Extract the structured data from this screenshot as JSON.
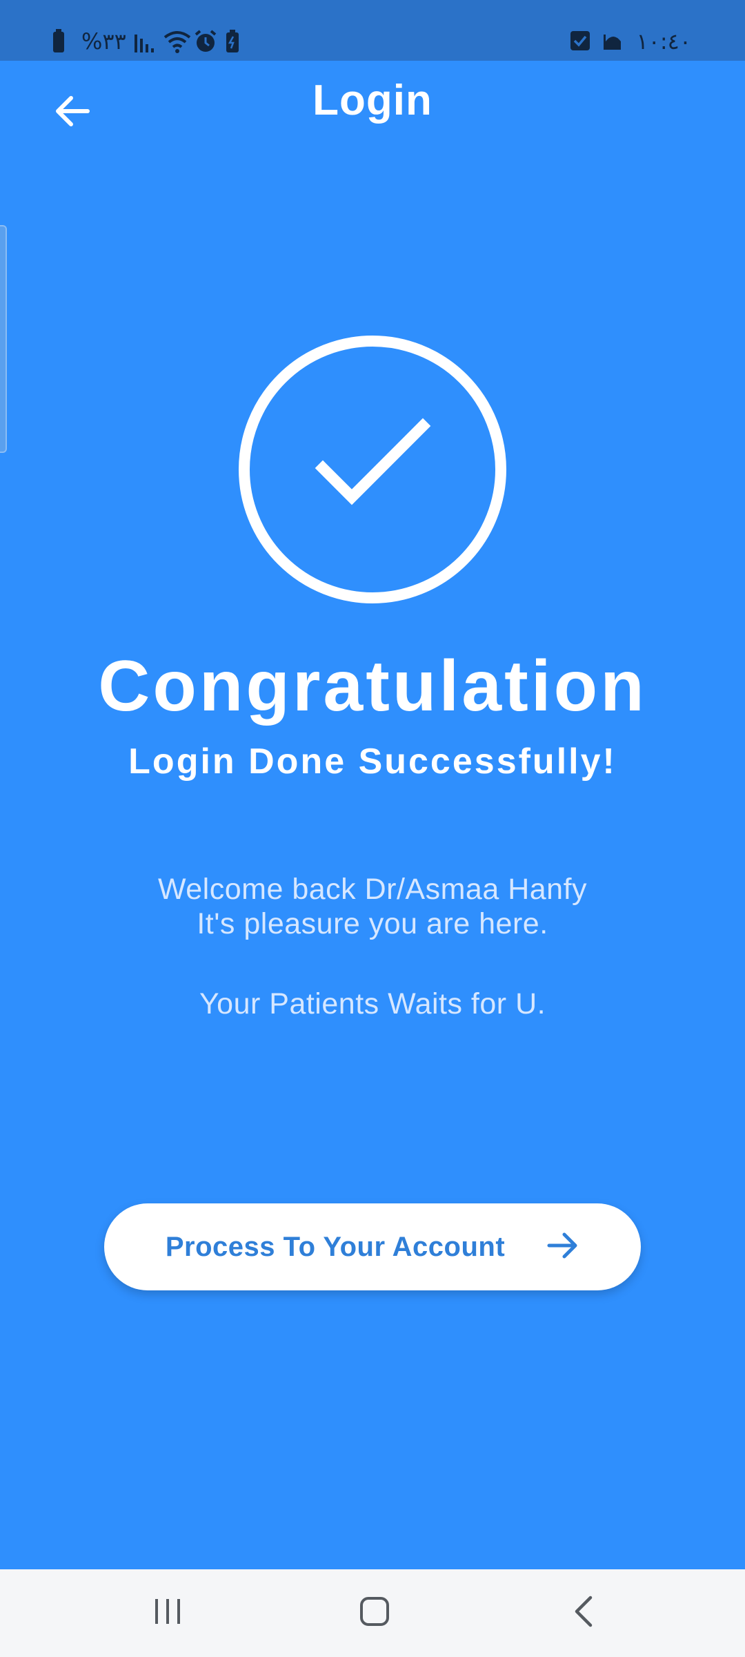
{
  "status_bar": {
    "battery_percent": "%٣٣",
    "time": "١٠:٤٠",
    "icons": [
      "battery-saver-icon",
      "signal-icon",
      "wifi-icon",
      "alarm-icon",
      "battery-icon",
      "checkbox-icon",
      "mosque-icon"
    ]
  },
  "header": {
    "title": "Login",
    "back_icon": "arrow-left-icon"
  },
  "success": {
    "icon": "check-circle-icon",
    "title": "Congratulation",
    "subtitle": "Login Done Successfully!",
    "welcome_line1": "Welcome back Dr/Asmaa Hanfy",
    "welcome_line2": "It's pleasure you are here.",
    "patients_line": "Your Patients Waits for U."
  },
  "cta": {
    "label": "Process To Your Account",
    "icon": "arrow-right-icon"
  },
  "nav": {
    "recents_icon": "recents-icon",
    "home_icon": "home-icon",
    "back_icon": "back-chevron-icon"
  },
  "colors": {
    "background": "#2f8ffd",
    "status_bar": "#2b72c8",
    "button_text": "#2f7fd8",
    "button_bg": "#ffffff"
  }
}
